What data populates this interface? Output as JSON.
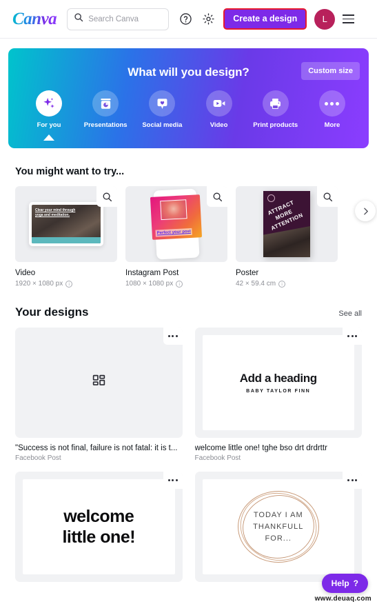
{
  "header": {
    "logo": "Canva",
    "search": {
      "placeholder": "Search Canva",
      "value": ""
    },
    "help_icon": "question-circle-icon",
    "settings_icon": "gear-icon",
    "create_button": "Create a design",
    "create_button_color": "#7d2ae8",
    "create_button_outline_color": "#e8192c",
    "avatar_initial": "L",
    "avatar_color": "#b8215b",
    "menu_icon": "hamburger-icon"
  },
  "hero": {
    "title": "What will you design?",
    "custom_size_label": "Custom size",
    "gradient_from": "#00c4cc",
    "gradient_to": "#8b3dff",
    "items": [
      {
        "label": "For you",
        "icon": "sparkle-icon",
        "active": true
      },
      {
        "label": "Presentations",
        "icon": "presentation-icon",
        "active": false
      },
      {
        "label": "Social media",
        "icon": "heart-chat-icon",
        "active": false
      },
      {
        "label": "Video",
        "icon": "video-camera-icon",
        "active": false
      },
      {
        "label": "Print products",
        "icon": "printer-icon",
        "active": false
      },
      {
        "label": "More",
        "icon": "ellipsis-icon",
        "active": false
      }
    ]
  },
  "try_section": {
    "title": "You might want to try...",
    "next_icon": "chevron-right-icon",
    "cards": [
      {
        "name": "Video",
        "size": "1920 × 1080 px",
        "info_icon": "info-icon",
        "search_icon": "magnifier-icon",
        "art_text": "Clear your mind through yoga and meditation."
      },
      {
        "name": "Instagram Post",
        "size": "1080 × 1080 px",
        "info_icon": "info-icon",
        "search_icon": "magnifier-icon",
        "art_text": "Perfect your post"
      },
      {
        "name": "Poster",
        "size": "42 × 59.4 cm",
        "info_icon": "info-icon",
        "search_icon": "magnifier-icon",
        "art_text": "ATTRACT MORE ATTENTION"
      }
    ]
  },
  "designs_section": {
    "title": "Your designs",
    "see_all": "See all",
    "cards": [
      {
        "title": "\"Success is not final, failure is not fatal: it is t...",
        "subtitle": "Facebook Post",
        "thumb_kind": "placeholder",
        "thumb_icon": "grid-squares-icon",
        "menu_icon": "ellipsis-icon"
      },
      {
        "title": "welcome little one! tghe bso drt drdrttr",
        "subtitle": "Facebook Post",
        "thumb_kind": "heading",
        "art_heading": "Add a heading",
        "art_subheading": "BABY TAYLOR FINN",
        "menu_icon": "ellipsis-icon"
      },
      {
        "title": "",
        "subtitle": "",
        "thumb_kind": "welcome",
        "art_line1": "welcome",
        "art_line2": "little one!",
        "menu_icon": "ellipsis-icon"
      },
      {
        "title": "",
        "subtitle": "",
        "thumb_kind": "thankful",
        "art_line1": "TODAY I AM",
        "art_line2": "THANKFULL",
        "art_line3": "FOR...",
        "menu_icon": "ellipsis-icon"
      }
    ]
  },
  "help_fab": {
    "label": "Help",
    "glyph": "?",
    "color": "#7d2ae8"
  },
  "watermark": "www.deuaq.com"
}
